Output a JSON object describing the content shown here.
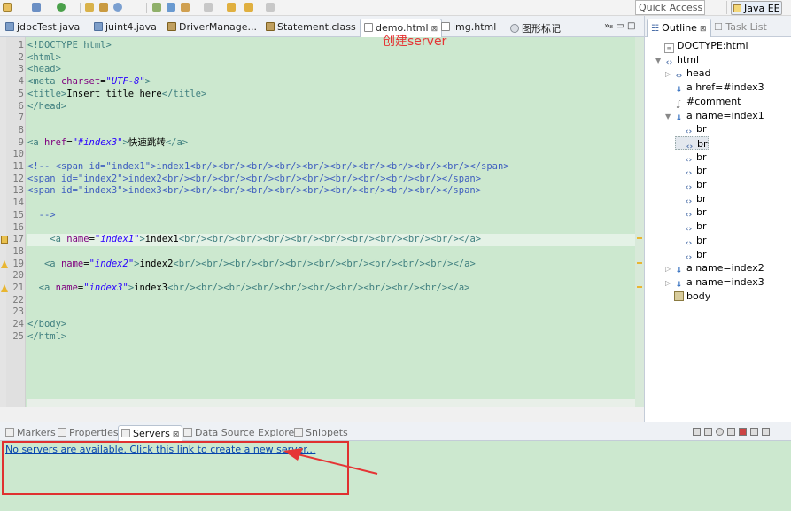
{
  "toolbar": {
    "quick_access": "Quick Access",
    "perspective": "Java EE"
  },
  "editor_tabs": [
    {
      "label": "jdbcTest.java",
      "kind": "java"
    },
    {
      "label": "juint4.java",
      "kind": "java"
    },
    {
      "label": "DriverManage...",
      "kind": "class"
    },
    {
      "label": "Statement.class",
      "kind": "class"
    },
    {
      "label": "demo.html",
      "kind": "html",
      "active": true,
      "close": "⊠"
    },
    {
      "label": "img.html",
      "kind": "html"
    },
    {
      "label": "图形标记",
      "kind": "globe"
    }
  ],
  "tab_overflow": "»₈",
  "code": {
    "line_numbers": [
      "1",
      "2",
      "3",
      "4",
      "5",
      "6",
      "7",
      "8",
      "9",
      "10",
      "11",
      "12",
      "13",
      "14",
      "15",
      "16",
      "17",
      "18",
      "19",
      "20",
      "21",
      "22",
      "23",
      "24",
      "25"
    ],
    "lines": [
      [
        {
          "c": "t",
          "s": "<!DOCTYPE html>"
        }
      ],
      [
        {
          "c": "t",
          "s": "<html>"
        }
      ],
      [
        {
          "c": "t",
          "s": "<head>"
        }
      ],
      [
        {
          "c": "t",
          "s": "<meta "
        },
        {
          "c": "a",
          "s": "charset"
        },
        {
          "c": "",
          "s": "="
        },
        {
          "c": "v",
          "s": "\"UTF-8\""
        },
        {
          "c": "t",
          "s": ">"
        }
      ],
      [
        {
          "c": "t",
          "s": "<title>"
        },
        {
          "c": "",
          "s": "Insert title here"
        },
        {
          "c": "t",
          "s": "</title>"
        }
      ],
      [
        {
          "c": "t",
          "s": "</head>"
        }
      ],
      [],
      [],
      [
        {
          "c": "t",
          "s": "<a "
        },
        {
          "c": "a",
          "s": "href"
        },
        {
          "c": "",
          "s": "="
        },
        {
          "c": "v",
          "s": "\"#index3\""
        },
        {
          "c": "t",
          "s": ">"
        },
        {
          "c": "",
          "s": "快速跳转"
        },
        {
          "c": "t",
          "s": "</a>"
        }
      ],
      [],
      [
        {
          "c": "cm",
          "s": "<!-- <span id=\"index1\">index1<br/><br/><br/><br/><br/><br/><br/><br/><br/><br/></span>"
        }
      ],
      [
        {
          "c": "cm",
          "s": "<span id=\"index2\">index2<br/><br/><br/><br/><br/><br/><br/><br/><br/><br/></span>"
        }
      ],
      [
        {
          "c": "cm",
          "s": "<span id=\"index3\">index3<br/><br/><br/><br/><br/><br/><br/><br/><br/><br/></span>"
        }
      ],
      [],
      [
        {
          "c": "cm",
          "s": "  -->"
        }
      ],
      [],
      [
        {
          "c": "",
          "s": "    "
        },
        {
          "c": "t",
          "s": "<a "
        },
        {
          "c": "a",
          "s": "name"
        },
        {
          "c": "",
          "s": "="
        },
        {
          "c": "v",
          "s": "\"index1\""
        },
        {
          "c": "t",
          "s": ">"
        },
        {
          "c": "",
          "s": "index1"
        },
        {
          "c": "t",
          "s": "<br/><br/><br/><br/><br/><br/><br/><br/><br/><br/></a>"
        }
      ],
      [],
      [
        {
          "c": "",
          "s": "   "
        },
        {
          "c": "t",
          "s": "<a "
        },
        {
          "c": "a",
          "s": "name"
        },
        {
          "c": "",
          "s": "="
        },
        {
          "c": "v",
          "s": "\"index2\""
        },
        {
          "c": "t",
          "s": ">"
        },
        {
          "c": "",
          "s": "index2"
        },
        {
          "c": "t",
          "s": "<br/><br/><br/><br/><br/><br/><br/><br/><br/><br/></a>"
        }
      ],
      [],
      [
        {
          "c": "",
          "s": "  "
        },
        {
          "c": "t",
          "s": "<a "
        },
        {
          "c": "a",
          "s": "name"
        },
        {
          "c": "",
          "s": "="
        },
        {
          "c": "v",
          "s": "\"index3\""
        },
        {
          "c": "t",
          "s": ">"
        },
        {
          "c": "",
          "s": "index3"
        },
        {
          "c": "t",
          "s": "<br/><br/><br/><br/><br/><br/><br/><br/><br/><br/></a>"
        }
      ],
      [],
      [],
      [
        {
          "c": "t",
          "s": "</body>"
        }
      ],
      [
        {
          "c": "t",
          "s": "</html>"
        }
      ]
    ],
    "current_line": 17
  },
  "outline": {
    "tab": "Outline",
    "tab_close": "⊠",
    "other_tab": "Task List",
    "items": [
      {
        "label": "DOCTYPE:html",
        "icon": "doctype",
        "depth": 0,
        "twisty": ""
      },
      {
        "label": "html",
        "icon": "element",
        "depth": 0,
        "twisty": "▼"
      },
      {
        "label": "head",
        "icon": "element",
        "depth": 1,
        "twisty": "▷"
      },
      {
        "label": "a href=#index3",
        "icon": "link",
        "depth": 1,
        "twisty": ""
      },
      {
        "label": "#comment",
        "icon": "comment",
        "depth": 1,
        "twisty": ""
      },
      {
        "label": "a name=index1",
        "icon": "link",
        "depth": 1,
        "twisty": "▼"
      },
      {
        "label": "br",
        "icon": "element",
        "depth": 2,
        "twisty": ""
      },
      {
        "label": "br",
        "icon": "element",
        "depth": 2,
        "twisty": "",
        "selected": true
      },
      {
        "label": "br",
        "icon": "element",
        "depth": 2,
        "twisty": ""
      },
      {
        "label": "br",
        "icon": "element",
        "depth": 2,
        "twisty": ""
      },
      {
        "label": "br",
        "icon": "element",
        "depth": 2,
        "twisty": ""
      },
      {
        "label": "br",
        "icon": "element",
        "depth": 2,
        "twisty": ""
      },
      {
        "label": "br",
        "icon": "element",
        "depth": 2,
        "twisty": ""
      },
      {
        "label": "br",
        "icon": "element",
        "depth": 2,
        "twisty": ""
      },
      {
        "label": "br",
        "icon": "element",
        "depth": 2,
        "twisty": ""
      },
      {
        "label": "br",
        "icon": "element",
        "depth": 2,
        "twisty": ""
      },
      {
        "label": "a name=index2",
        "icon": "link",
        "depth": 1,
        "twisty": "▷"
      },
      {
        "label": "a name=index3",
        "icon": "link",
        "depth": 1,
        "twisty": "▷"
      },
      {
        "label": "body",
        "icon": "body",
        "depth": 1,
        "twisty": ""
      }
    ]
  },
  "bottom_tabs": [
    {
      "label": "Markers"
    },
    {
      "label": "Properties"
    },
    {
      "label": "Servers",
      "active": true,
      "close": "⊠"
    },
    {
      "label": "Data Source Explorer"
    },
    {
      "label": "Snippets"
    }
  ],
  "servers": {
    "link": "No servers are available. Click this link to create a new server..."
  },
  "annotation": {
    "text": "创建server",
    "color": "#e53535"
  }
}
